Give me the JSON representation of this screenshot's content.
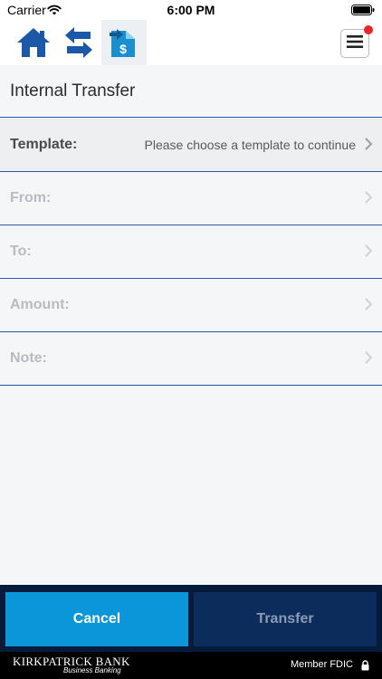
{
  "status_bar": {
    "carrier": "Carrier",
    "time": "6:00 PM"
  },
  "nav": {
    "icons": [
      "home-icon",
      "swap-arrows-icon",
      "transfer-dollar-icon",
      "hamburger-menu-icon"
    ],
    "colors": {
      "primary": "#1c58a8",
      "transfer_icon": "#1a8fd0",
      "notification_dot": "#e8262a"
    }
  },
  "page": {
    "title": "Internal Transfer"
  },
  "form": {
    "template": {
      "label": "Template:",
      "value": "Please choose a template to continue"
    },
    "from": {
      "label": "From:"
    },
    "to": {
      "label": "To:"
    },
    "amount": {
      "label": "Amount:"
    },
    "note": {
      "label": "Note:"
    }
  },
  "actions": {
    "cancel_label": "Cancel",
    "transfer_label": "Transfer",
    "colors": {
      "cancel": "#0a96d8",
      "transfer": "#0c2d5c",
      "bar": "#061a3a"
    }
  },
  "footer": {
    "bank_name": "KIRKPATRICK BANK",
    "bank_sub": "Business Banking",
    "fdic": "Member FDIC"
  }
}
